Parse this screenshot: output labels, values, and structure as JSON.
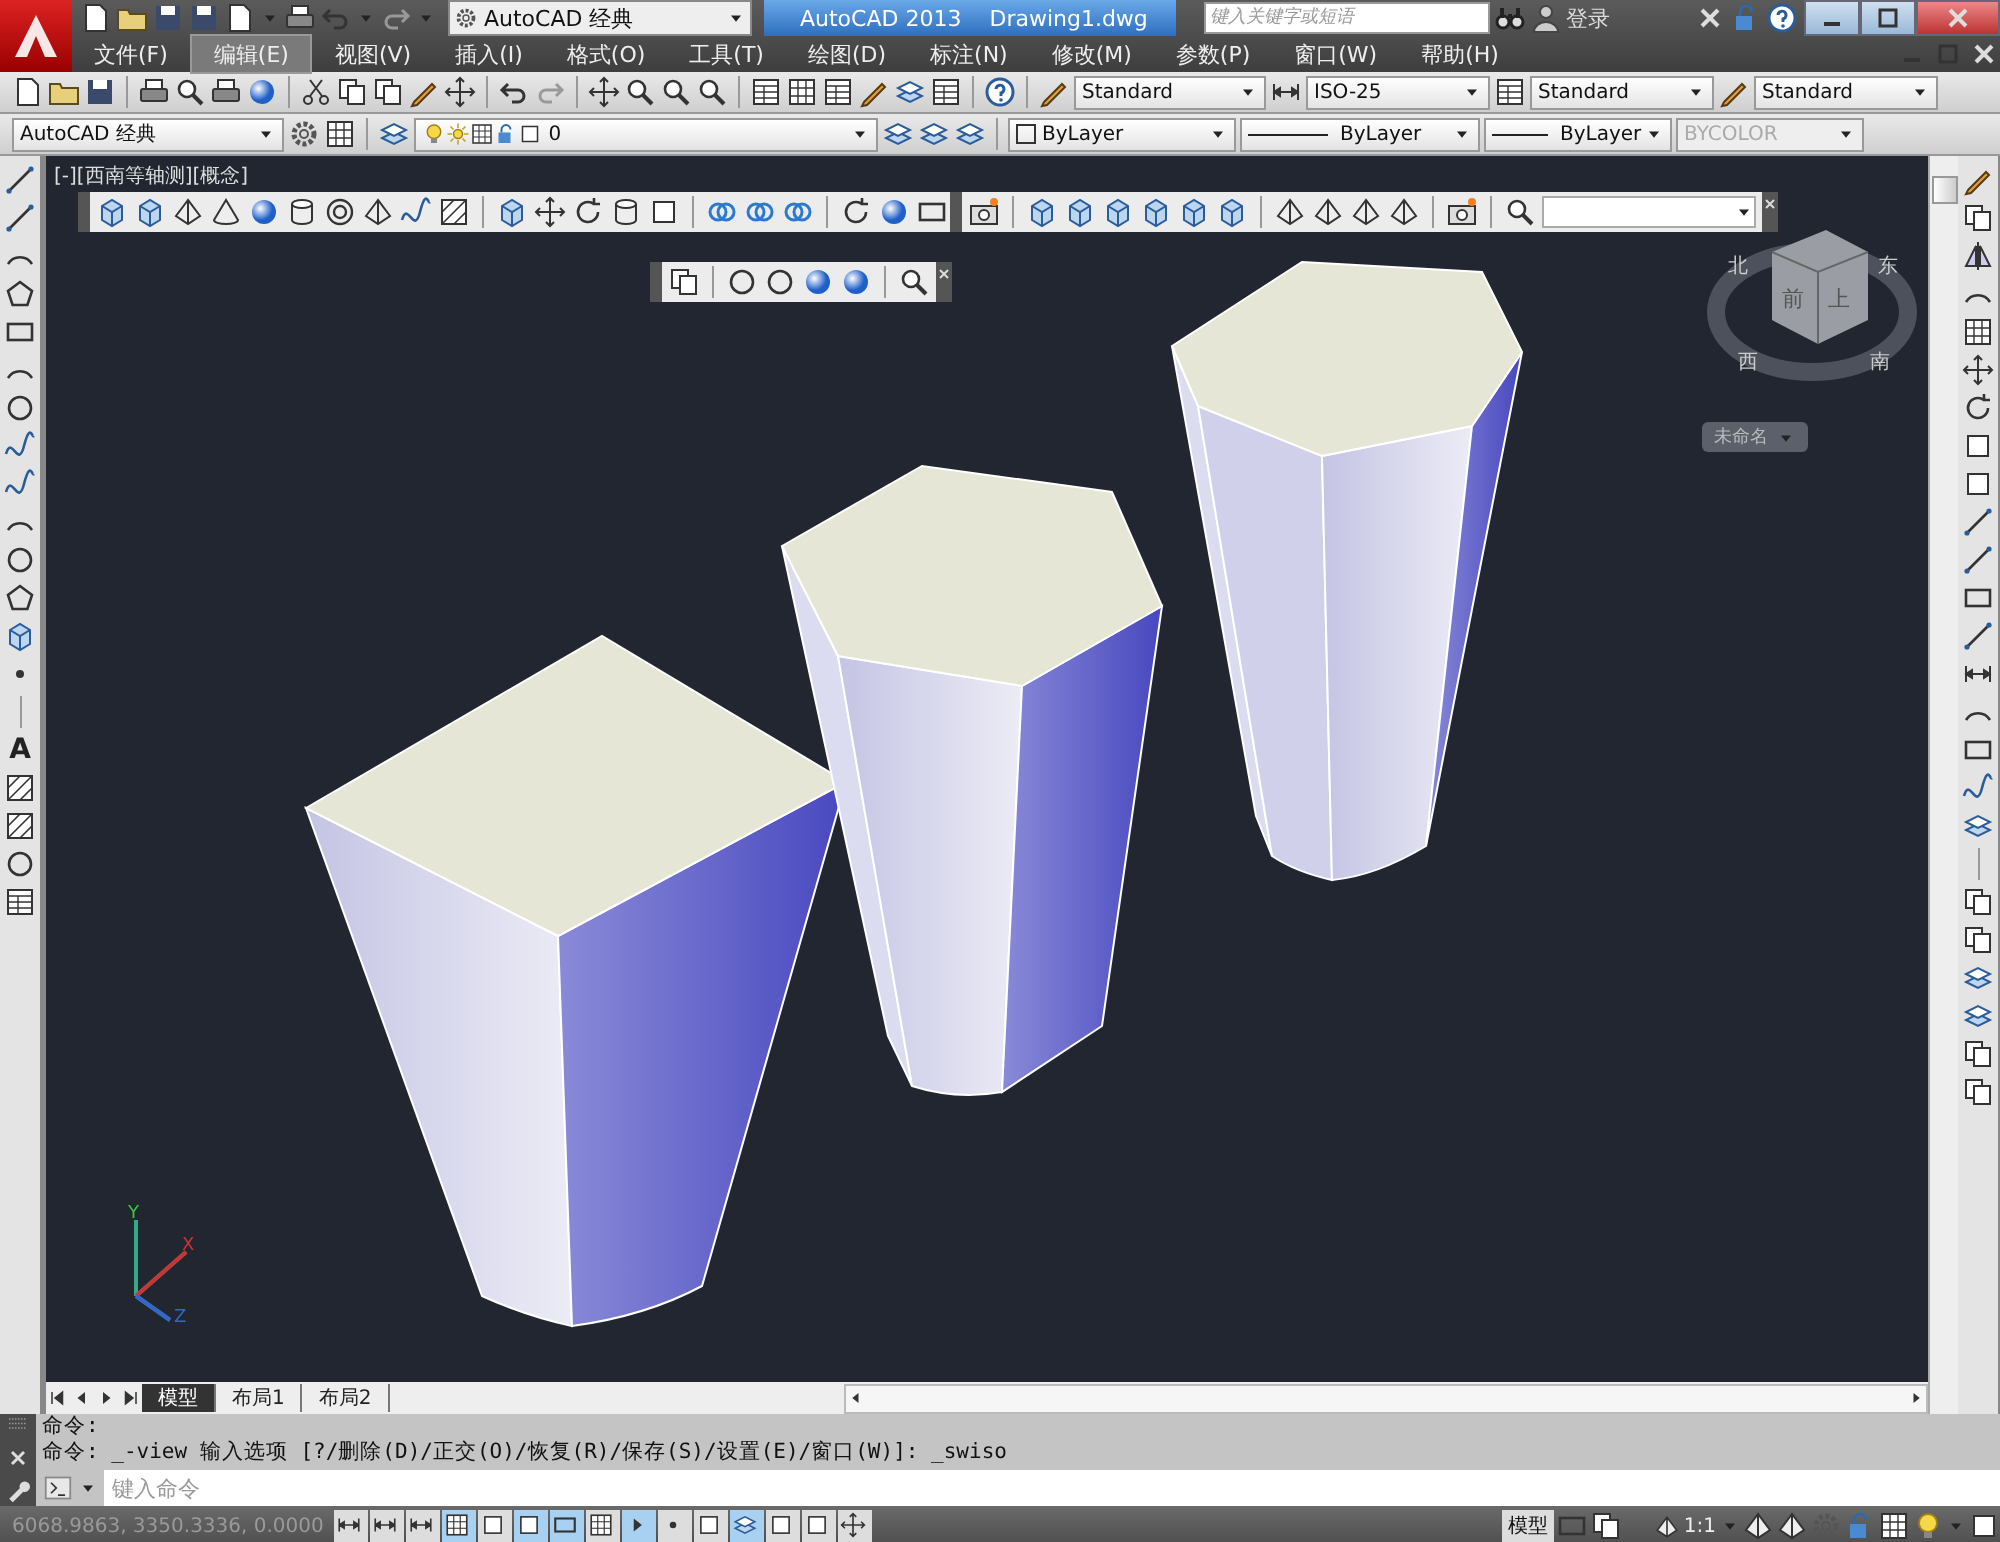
{
  "title_bar": {
    "workspace": "AutoCAD 经典",
    "app_name": "AutoCAD 2013",
    "document": "Drawing1.dwg",
    "search": {
      "placeholder": "键入关键字或短语"
    },
    "sign_in": "登录"
  },
  "menu_bar": {
    "items": [
      {
        "label": "文件(F)",
        "selected": false
      },
      {
        "label": "编辑(E)",
        "selected": true
      },
      {
        "label": "视图(V)",
        "selected": false
      },
      {
        "label": "插入(I)",
        "selected": false
      },
      {
        "label": "格式(O)",
        "selected": false
      },
      {
        "label": "工具(T)",
        "selected": false
      },
      {
        "label": "绘图(D)",
        "selected": false
      },
      {
        "label": "标注(N)",
        "selected": false
      },
      {
        "label": "修改(M)",
        "selected": false
      },
      {
        "label": "参数(P)",
        "selected": false
      },
      {
        "label": "窗口(W)",
        "selected": false
      },
      {
        "label": "帮助(H)",
        "selected": false
      }
    ]
  },
  "styles_toolbar": {
    "text_style": "Standard",
    "dimension_style": "ISO-25",
    "table_style": "Standard",
    "multileader_style": "Standard"
  },
  "workspaces_toolbar": {
    "workspace": "AutoCAD 经典"
  },
  "layers_toolbar": {
    "current_layer": "0"
  },
  "properties_toolbar": {
    "color_setting": "ByLayer",
    "linetype": "ByLayer",
    "lineweight": "ByLayer",
    "plot_style": {
      "value": "BYCOLOR",
      "disabled": true
    }
  },
  "draw_toolbar": {
    "text_tool": "A"
  },
  "viewport": {
    "label": "[-][西南等轴测][概念]",
    "view_cube": {
      "faces": [
        "前",
        "上"
      ],
      "compass": [
        "北",
        "东",
        "西",
        "南"
      ],
      "ucs_menu": "未命名"
    },
    "ucs_axes": [
      "X",
      "Y",
      "Z"
    ]
  },
  "layout_tabs": [
    {
      "label": "模型",
      "selected": true
    },
    {
      "label": "布局1",
      "selected": false
    },
    {
      "label": "布局2",
      "selected": false
    }
  ],
  "command_line": {
    "history": [
      "命令:",
      "命令: _-view 输入选项 [?/删除(D)/正交(O)/恢复(R)/保存(S)/设置(E)/窗口(W)]: _swiso"
    ],
    "input": {
      "placeholder": "键入命令"
    }
  },
  "status_bar": {
    "coordinates": "6068.9863, 3350.3336, 0.0000",
    "toggles": [
      {
        "on": false
      },
      {
        "on": false
      },
      {
        "on": false
      },
      {
        "on": true
      },
      {
        "on": false
      },
      {
        "on": true
      },
      {
        "on": true
      },
      {
        "on": false
      },
      {
        "on": true
      },
      {
        "on": false
      },
      {
        "on": false
      },
      {
        "on": true
      },
      {
        "on": false
      },
      {
        "on": false
      },
      {
        "on": false
      }
    ],
    "space": "模型",
    "annotation_scale": "1:1"
  }
}
